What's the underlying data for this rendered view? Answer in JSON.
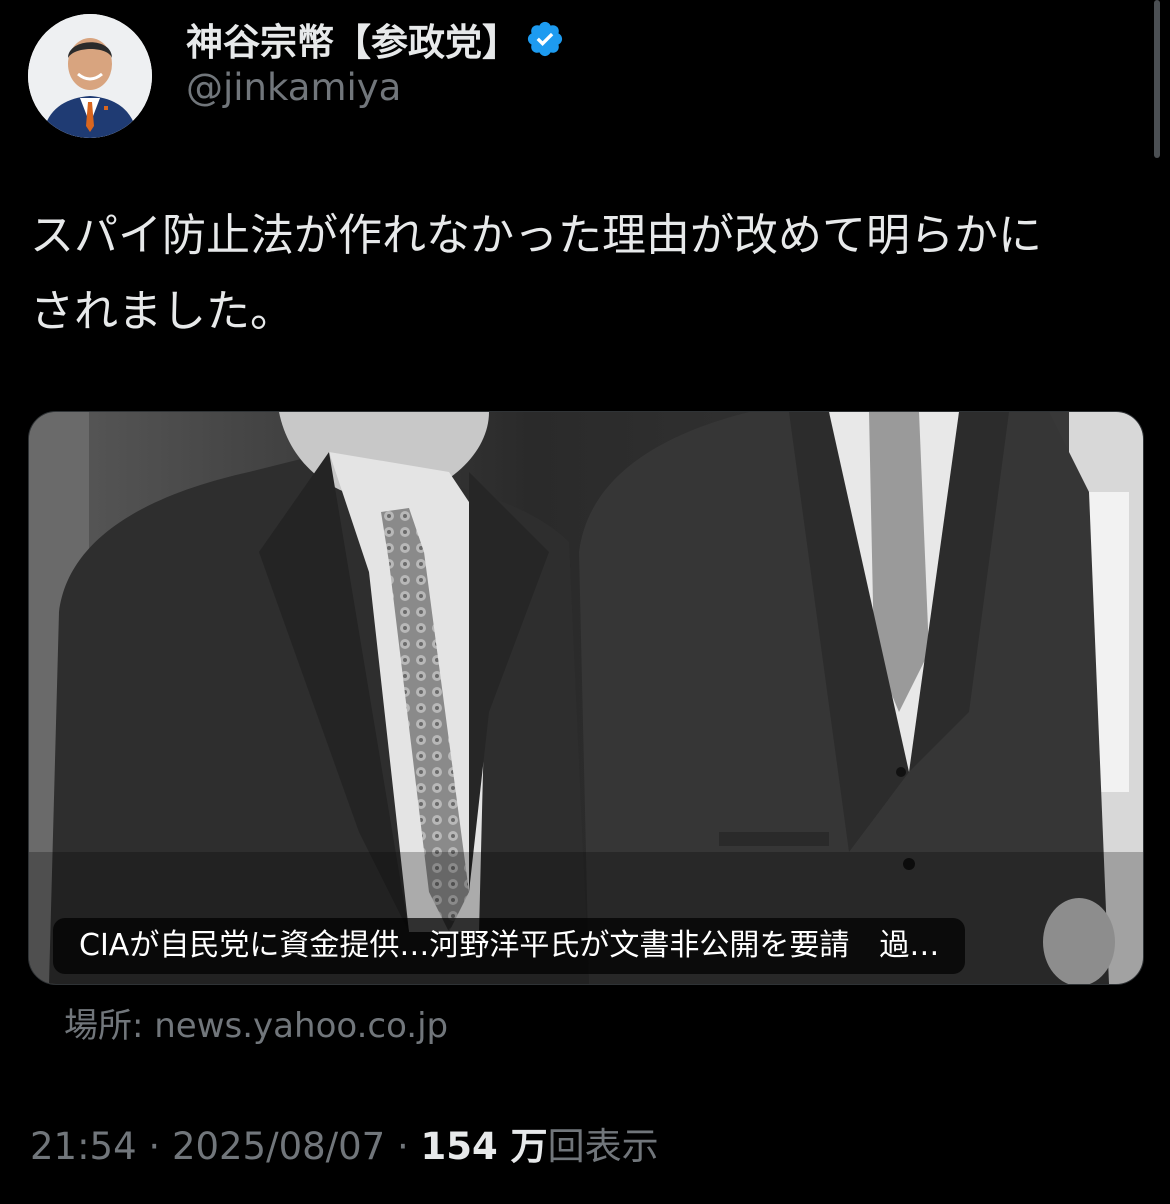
{
  "author": {
    "display_name": "神谷宗幣【参政党】",
    "handle": "@jinkamiya",
    "verified_color": "#1d9bf0"
  },
  "tweet": {
    "text_line_1": "スパイ防止法が作れなかった理由が改めて明らかに",
    "text_line_2": "されました。"
  },
  "link_card": {
    "title": "CIAが自民党に資金提供…河野洋平氏が文書非公開を要請　過…",
    "source": "場所: news.yahoo.co.jp"
  },
  "meta": {
    "time": "21:54",
    "sep1": " · ",
    "date": "2025/08/07",
    "sep2": " · ",
    "views_count": "154 万",
    "views_label": "回表示"
  }
}
